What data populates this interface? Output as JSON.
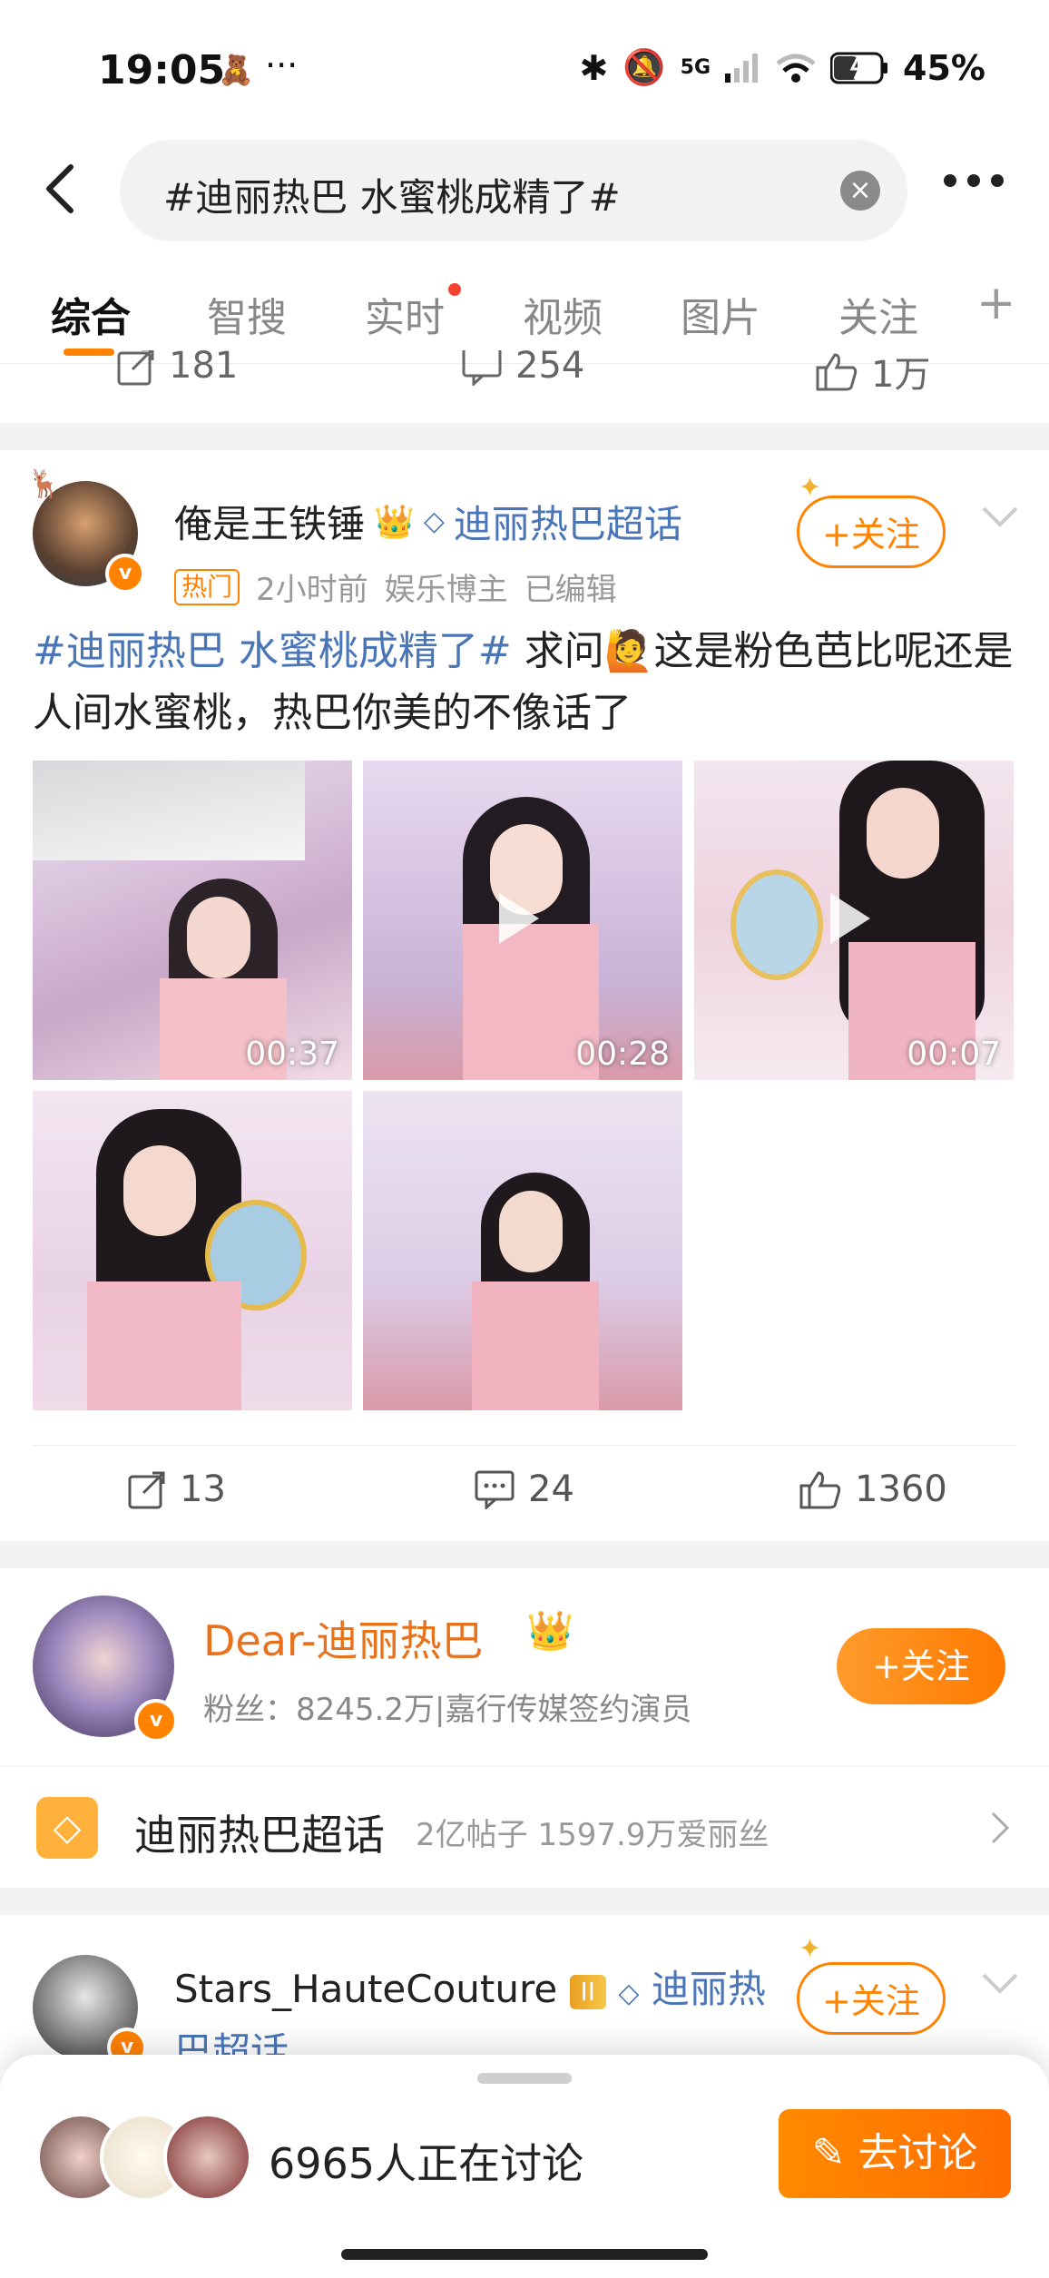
{
  "status_bar": {
    "time": "19:05",
    "time_more": "···",
    "network": "5G",
    "battery": "45%"
  },
  "search": {
    "query": "#迪丽热巴 水蜜桃成精了#"
  },
  "tabs": [
    {
      "label": "综合",
      "active": true
    },
    {
      "label": "智搜"
    },
    {
      "label": "实时",
      "dot": true
    },
    {
      "label": "视频"
    },
    {
      "label": "图片"
    },
    {
      "label": "关注"
    }
  ],
  "tabs_add": "+",
  "prev_post_actions": {
    "repost": "181",
    "comment": "254",
    "like": "1万"
  },
  "post": {
    "username": "俺是王铁锤",
    "supertopic": "迪丽热巴超话",
    "follow_label": "+关注",
    "hot_tag": "热门",
    "time": "2小时前",
    "role": "娱乐博主",
    "edited": "已编辑",
    "topic": "#迪丽热巴 水蜜桃成精了#",
    "text": " 求问🙋这是粉色芭比呢还是人间水蜜桃，热巴你美的不像话了",
    "media": [
      {
        "type": "video",
        "duration": "00:37"
      },
      {
        "type": "video",
        "duration": "00:28"
      },
      {
        "type": "video",
        "duration": "00:07"
      },
      {
        "type": "image"
      },
      {
        "type": "image"
      }
    ],
    "actions": {
      "repost": "13",
      "comment": "24",
      "like": "1360"
    }
  },
  "user_card": {
    "name": "Dear-迪丽热巴",
    "fans": "粉丝：8245.2万|嘉行传媒签约演员",
    "follow_label": "+关注"
  },
  "supertopic_row": {
    "name": "迪丽热巴超话",
    "stats": "2亿帖子  1597.9万爱丽丝"
  },
  "post2": {
    "username": "Stars_HauteCouture",
    "level": "II",
    "supertopic": "迪丽热巴超话",
    "follow_label": "+关注"
  },
  "bottom_bar": {
    "discussing": "6965人正在讨论",
    "button": "去讨论"
  },
  "colors": {
    "accent": "#ff8200",
    "link": "#4a76b8"
  }
}
